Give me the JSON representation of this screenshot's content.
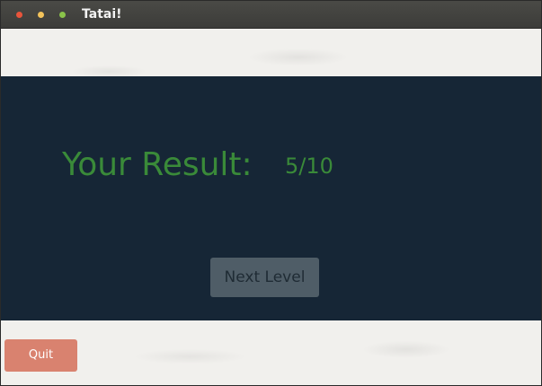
{
  "window": {
    "title": "Tatai!",
    "controls": [
      "close-icon",
      "minimize-icon",
      "maximize-icon"
    ]
  },
  "result": {
    "label": "Your Result:",
    "score": "5/10"
  },
  "buttons": {
    "next_level": "Next Level",
    "quit": "Quit"
  },
  "colors": {
    "panel_background": "#162636",
    "result_text": "#3a8a39",
    "next_level_button": "#4f5d67",
    "quit_button": "#d9826f",
    "close": "#e8543b",
    "minimize": "#f3c35b",
    "maximize": "#8ac34a"
  }
}
